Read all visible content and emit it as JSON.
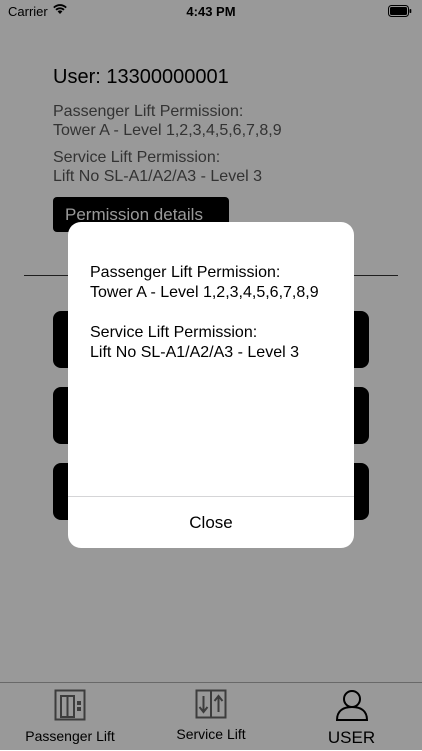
{
  "status_bar": {
    "carrier": "Carrier",
    "time": "4:43 PM"
  },
  "user": {
    "title": "User: 13300000001",
    "passenger_label": "Passenger Lift Permission:",
    "passenger_value": "Tower A - Level 1,2,3,4,5,6,7,8,9",
    "service_label": "Service Lift Permission:",
    "service_value": "Lift No SL-A1/A2/A3 - Level 3",
    "details_button": "Permission details"
  },
  "tabs": [
    {
      "label": "Passenger Lift",
      "icon": "elevator-icon"
    },
    {
      "label": "Service Lift",
      "icon": "lift-arrows-icon"
    },
    {
      "label": "USER",
      "icon": "user-icon"
    }
  ],
  "alert": {
    "message": "Passenger Lift Permission:\nTower A - Level 1,2,3,4,5,6,7,8,9\n\nService Lift Permission:\nLift No SL-A1/A2/A3 - Level 3",
    "close_label": "Close"
  }
}
